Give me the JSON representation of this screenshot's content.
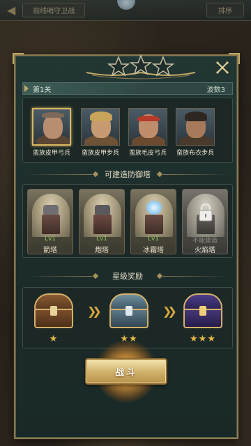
{
  "top_bar": {
    "title": "前线哨守卫战",
    "right_label": "排序"
  },
  "stage": {
    "label": "第1关",
    "wave": "波数3"
  },
  "stars": {
    "earned": 0,
    "total": 3
  },
  "enemies": [
    {
      "name": "蛮族皮甲弓兵",
      "selected": true
    },
    {
      "name": "蛮族皮甲步兵",
      "selected": false
    },
    {
      "name": "蛮族毛皮弓兵",
      "selected": false
    },
    {
      "name": "蛮族布衣步兵",
      "selected": false
    }
  ],
  "towers_section": {
    "title": "可建造防御塔"
  },
  "towers": [
    {
      "level": "Lv1",
      "name": "箭塔",
      "locked": false
    },
    {
      "level": "Lv1",
      "name": "炮塔",
      "locked": false
    },
    {
      "level": "Lv1",
      "name": "冰霜塔",
      "locked": false
    },
    {
      "level": "不能建造",
      "name": "火焰塔",
      "locked": true
    }
  ],
  "rewards_section": {
    "title": "星级奖励"
  },
  "rewards": [
    {
      "stars": "★",
      "theme": "bronze"
    },
    {
      "stars": "★★",
      "theme": "silver"
    },
    {
      "stars": "★★★",
      "theme": "royal"
    }
  ],
  "fight_button": {
    "label": "战斗"
  },
  "colors": {
    "accent_gold": "#d8b560",
    "level_green": "#8ec75a",
    "panel_bg": "#1c2c2a"
  }
}
